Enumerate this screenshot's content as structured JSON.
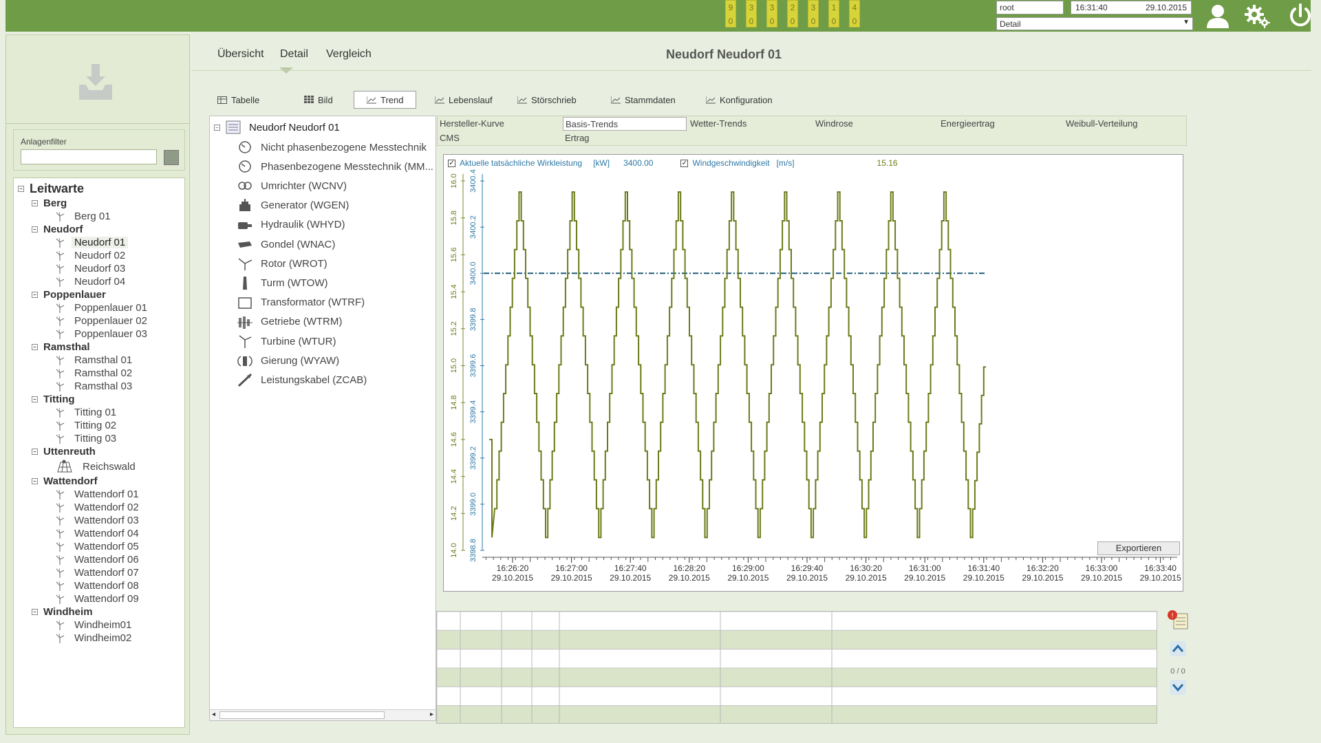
{
  "topbar": {
    "counters": [
      {
        "top": "9",
        "bottom": "0"
      },
      {
        "top": "3",
        "bottom": "0"
      },
      {
        "top": "3",
        "bottom": "0"
      },
      {
        "top": "2",
        "bottom": "0"
      },
      {
        "top": "3",
        "bottom": "0"
      },
      {
        "top": "1",
        "bottom": "0"
      },
      {
        "top": "4",
        "bottom": "0"
      }
    ],
    "user": "root",
    "time": "16:31:40",
    "date": "29.10.2015",
    "view_select": "Detail",
    "colors": {
      "bar": "#6f9c47",
      "counter": "#d7d43a"
    }
  },
  "left": {
    "filter_label": "Anlagenfilter",
    "filter_value": "",
    "tree": {
      "root": "Leitwarte",
      "groups": [
        {
          "name": "Berg",
          "items": [
            "Berg 01"
          ]
        },
        {
          "name": "Neudorf",
          "items": [
            "Neudorf 01",
            "Neudorf 02",
            "Neudorf 03",
            "Neudorf 04"
          ]
        },
        {
          "name": "Poppenlauer",
          "items": [
            "Poppenlauer 01",
            "Poppenlauer 02",
            "Poppenlauer 03"
          ]
        },
        {
          "name": "Ramsthal",
          "items": [
            "Ramsthal 01",
            "Ramsthal 02",
            "Ramsthal 03"
          ]
        },
        {
          "name": "Titting",
          "items": [
            "Titting 01",
            "Titting 02",
            "Titting 03"
          ]
        },
        {
          "name": "Uttenreuth",
          "items": [
            "Reichswald"
          ]
        },
        {
          "name": "Wattendorf",
          "items": [
            "Wattendorf 01",
            "Wattendorf 02",
            "Wattendorf 03",
            "Wattendorf 04",
            "Wattendorf 05",
            "Wattendorf 06",
            "Wattendorf 07",
            "Wattendorf 08",
            "Wattendorf 09"
          ]
        },
        {
          "name": "Windheim",
          "items": [
            "Windheim01",
            "Windheim02"
          ]
        }
      ],
      "selected": "Neudorf 01"
    }
  },
  "main": {
    "tabs": [
      "Übersicht",
      "Detail",
      "Vergleich"
    ],
    "active_tab": "Detail",
    "title": "Neudorf Neudorf 01",
    "subtabs": [
      "Tabelle",
      "Bild",
      "Trend",
      "Lebenslauf",
      "Störschrieb",
      "Stammdaten",
      "Konfiguration"
    ],
    "active_subtab": "Trend"
  },
  "components": {
    "root": "Neudorf Neudorf 01",
    "items": [
      {
        "label": "Nicht phasenbezogene Messtechnik",
        "icon": "gauge-icon"
      },
      {
        "label": "Phasenbezogene Messtechnik (MM...",
        "icon": "gauge-icon"
      },
      {
        "label": "Umrichter (WCNV)",
        "icon": "converter-icon"
      },
      {
        "label": "Generator (WGEN)",
        "icon": "generator-icon"
      },
      {
        "label": "Hydraulik (WHYD)",
        "icon": "hydraulic-icon"
      },
      {
        "label": "Gondel (WNAC)",
        "icon": "nacelle-icon"
      },
      {
        "label": "Rotor (WROT)",
        "icon": "rotor-icon"
      },
      {
        "label": "Turm (WTOW)",
        "icon": "tower-icon"
      },
      {
        "label": "Transformator (WTRF)",
        "icon": "transformer-icon"
      },
      {
        "label": "Getriebe (WTRM)",
        "icon": "gearbox-icon"
      },
      {
        "label": "Turbine (WTUR)",
        "icon": "turbine-icon"
      },
      {
        "label": "Gierung (WYAW)",
        "icon": "yaw-icon"
      },
      {
        "label": "Leistungskabel (ZCAB)",
        "icon": "cable-icon"
      }
    ]
  },
  "trend_tabs": {
    "row1": [
      "Hersteller-Kurve",
      "Basis-Trends",
      "Wetter-Trends",
      "Windrose",
      "Energieertrag",
      "Weibull-Verteilung"
    ],
    "row2": [
      "CMS",
      "Ertrag"
    ],
    "active": "Basis-Trends"
  },
  "chart_data": {
    "type": "line",
    "series": [
      {
        "name": "Aktuelle tatsächliche Wirkleistung",
        "unit": "[kW]",
        "current": "3400.00",
        "checked": true,
        "color": "#1c5a74",
        "values_constant": 3400.0
      },
      {
        "name": "Windgeschwindigkeit",
        "unit": "[m/s]",
        "current": "15.16",
        "checked": true,
        "color": "#6b7a18",
        "min": 14.07,
        "max": 15.94,
        "cycles": 9,
        "start_value": 14.6,
        "end_value": 15.3
      }
    ],
    "y_left": {
      "ticks": [
        "14.0",
        "14.2",
        "14.4",
        "14.6",
        "14.8",
        "15.0",
        "15.2",
        "15.4",
        "15.6",
        "15.8",
        "16.0"
      ],
      "min": 14.0,
      "max": 16.0
    },
    "y_right": {
      "ticks": [
        "3398.8",
        "3399.0",
        "3399.2",
        "3399.4",
        "3399.6",
        "3399.8",
        "3400.0",
        "3400.2",
        "3400.4"
      ],
      "min": 3398.8,
      "max": 3400.4
    },
    "x_ticks": [
      {
        "time": "16:26:20",
        "date": "29.10.2015"
      },
      {
        "time": "16:27:00",
        "date": "29.10.2015"
      },
      {
        "time": "16:27:40",
        "date": "29.10.2015"
      },
      {
        "time": "16:28:20",
        "date": "29.10.2015"
      },
      {
        "time": "16:29:00",
        "date": "29.10.2015"
      },
      {
        "time": "16:29:40",
        "date": "29.10.2015"
      },
      {
        "time": "16:30:20",
        "date": "29.10.2015"
      },
      {
        "time": "16:31:00",
        "date": "29.10.2015"
      },
      {
        "time": "16:31:40",
        "date": "29.10.2015"
      },
      {
        "time": "16:32:20",
        "date": "29.10.2015"
      },
      {
        "time": "16:33:00",
        "date": "29.10.2015"
      },
      {
        "time": "16:33:40",
        "date": "29.10.2015"
      }
    ],
    "export_label": "Exportieren"
  },
  "pager": {
    "count": "0 / 0"
  }
}
